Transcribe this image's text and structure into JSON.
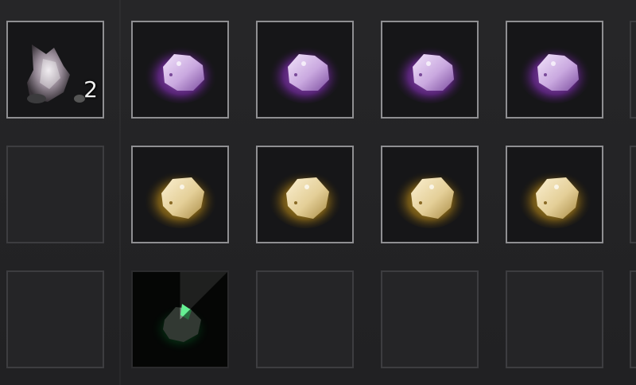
{
  "inventory": {
    "slots": [
      {
        "row": 0,
        "col": 0,
        "state": "filled",
        "item": "dust-powder-icon",
        "quantity": "2"
      },
      {
        "row": 0,
        "col": 1,
        "state": "filled",
        "item": "purple-ore-icon"
      },
      {
        "row": 0,
        "col": 2,
        "state": "filled",
        "item": "purple-ore-icon"
      },
      {
        "row": 0,
        "col": 3,
        "state": "filled",
        "item": "purple-ore-icon"
      },
      {
        "row": 0,
        "col": 4,
        "state": "filled",
        "item": "purple-ore-icon"
      },
      {
        "row": 1,
        "col": 0,
        "state": "empty"
      },
      {
        "row": 1,
        "col": 1,
        "state": "filled",
        "item": "gold-ore-icon"
      },
      {
        "row": 1,
        "col": 2,
        "state": "filled",
        "item": "gold-ore-icon"
      },
      {
        "row": 1,
        "col": 3,
        "state": "filled",
        "item": "gold-ore-icon"
      },
      {
        "row": 1,
        "col": 4,
        "state": "filled",
        "item": "gold-ore-icon"
      },
      {
        "row": 2,
        "col": 0,
        "state": "empty"
      },
      {
        "row": 2,
        "col": 1,
        "state": "cooldown",
        "item": "green-ore-icon"
      },
      {
        "row": 2,
        "col": 2,
        "state": "empty"
      },
      {
        "row": 2,
        "col": 3,
        "state": "empty"
      },
      {
        "row": 2,
        "col": 4,
        "state": "empty"
      }
    ],
    "colors": {
      "purple_glow": "#b05ae0",
      "gold_glow": "#e0b020",
      "green_glow": "#2ad65a",
      "slot_border": "#8f8f92",
      "background": "#222224"
    }
  }
}
